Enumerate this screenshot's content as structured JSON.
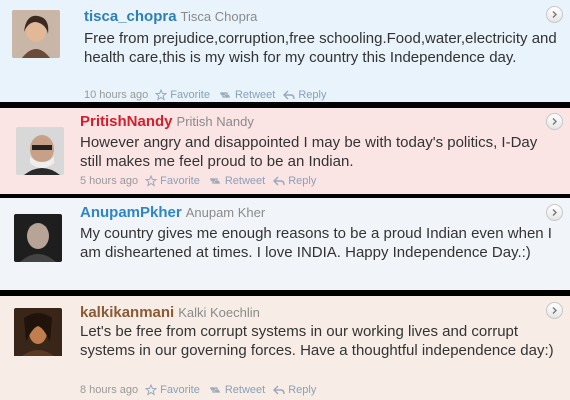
{
  "tweets": [
    {
      "username": "tisca_chopra",
      "fullname": "Tisca Chopra",
      "text": "Free from prejudice,corruption,free schooling.Food,water,electricity and health care,this is my wish for my country this Independence day.",
      "time": "10 hours ago",
      "favorite_label": "Favorite",
      "retweet_label": "Retweet",
      "reply_label": "Reply",
      "bg_color": "#e9f3fb",
      "username_color": "#2d7fb8"
    },
    {
      "username": "PritishNandy",
      "fullname": "Pritish Nandy",
      "text": "However angry and disappointed I may be with today's politics, I-Day still makes me feel proud to be an Indian.",
      "time": "5 hours ago",
      "favorite_label": "Favorite",
      "retweet_label": "Retweet",
      "reply_label": "Reply",
      "bg_color": "#fbe4e4",
      "username_color": "#d21f2b"
    },
    {
      "username": "AnupamPkher",
      "fullname": "Anupam Kher",
      "text": "My country gives me enough reasons to be a proud Indian even when I am disheartened at times. I love INDIA. Happy Independence Day.:)",
      "time": "",
      "favorite_label": "",
      "retweet_label": "",
      "reply_label": "",
      "bg_color": "#f1f5f9",
      "username_color": "#2e86c8"
    },
    {
      "username": "kalkikanmani",
      "fullname": "Kalki Koechlin",
      "text": "Let's be free from corrupt systems in our working lives and corrupt systems in our governing forces. Have a thoughtful independence day:)",
      "time": "8 hours ago",
      "favorite_label": "Favorite",
      "retweet_label": "Retweet",
      "reply_label": "Reply",
      "bg_color": "#f7ede6",
      "username_color": "#8a5a35"
    }
  ]
}
